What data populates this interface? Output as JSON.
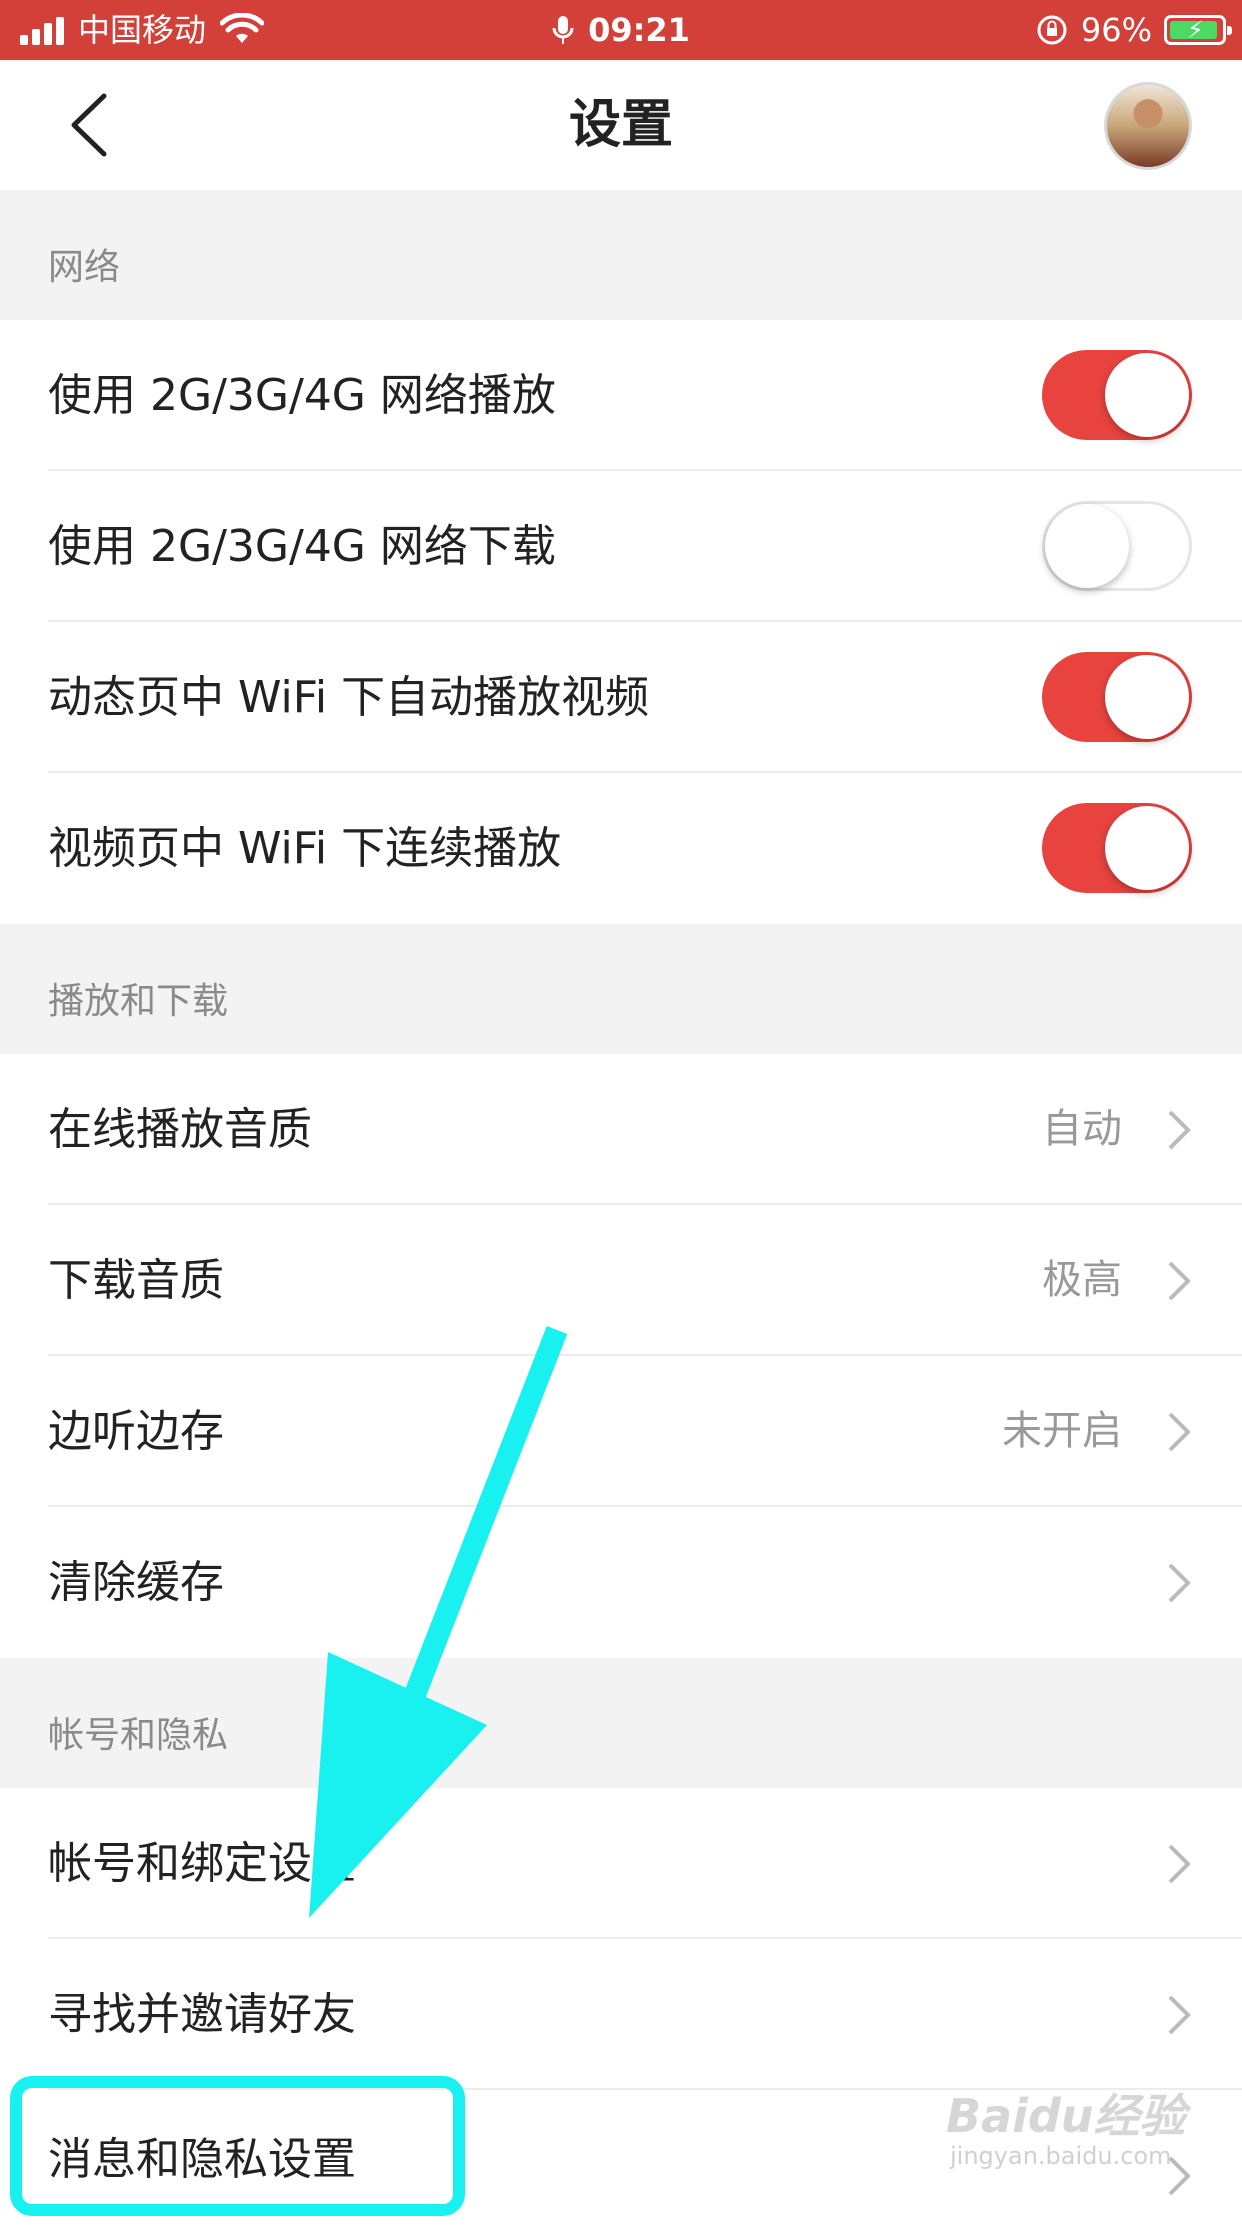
{
  "status_bar": {
    "carrier": "中国移动",
    "time": "09:21",
    "battery_percent": "96%",
    "battery_level": 0.96,
    "charging": true
  },
  "nav": {
    "title": "设置",
    "back_icon": "chevron-left-icon",
    "avatar_icon": "user-avatar"
  },
  "sections": {
    "network": {
      "header": "网络",
      "rows": [
        {
          "label": "使用 2G/3G/4G 网络播放",
          "toggle": true
        },
        {
          "label": "使用 2G/3G/4G 网络下载",
          "toggle": false
        },
        {
          "label": "动态页中 WiFi 下自动播放视频",
          "toggle": true
        },
        {
          "label": "视频页中 WiFi 下连续播放",
          "toggle": true
        }
      ]
    },
    "playback": {
      "header": "播放和下载",
      "rows": [
        {
          "label": "在线播放音质",
          "value": "自动"
        },
        {
          "label": "下载音质",
          "value": "极高"
        },
        {
          "label": "边听边存",
          "value": "未开启"
        },
        {
          "label": "清除缓存",
          "value": ""
        }
      ]
    },
    "account": {
      "header": "帐号和隐私",
      "rows": [
        {
          "label": "帐号和绑定设置"
        },
        {
          "label": "寻找并邀请好友"
        },
        {
          "label": "消息和隐私设置"
        }
      ]
    }
  },
  "colors": {
    "status_bar": "#d3403a",
    "toggle_on": "#e8433f",
    "annotation": "#19f1f1"
  },
  "watermark": {
    "brand": "Baidu经验",
    "url": "jingyan.baidu.com"
  }
}
